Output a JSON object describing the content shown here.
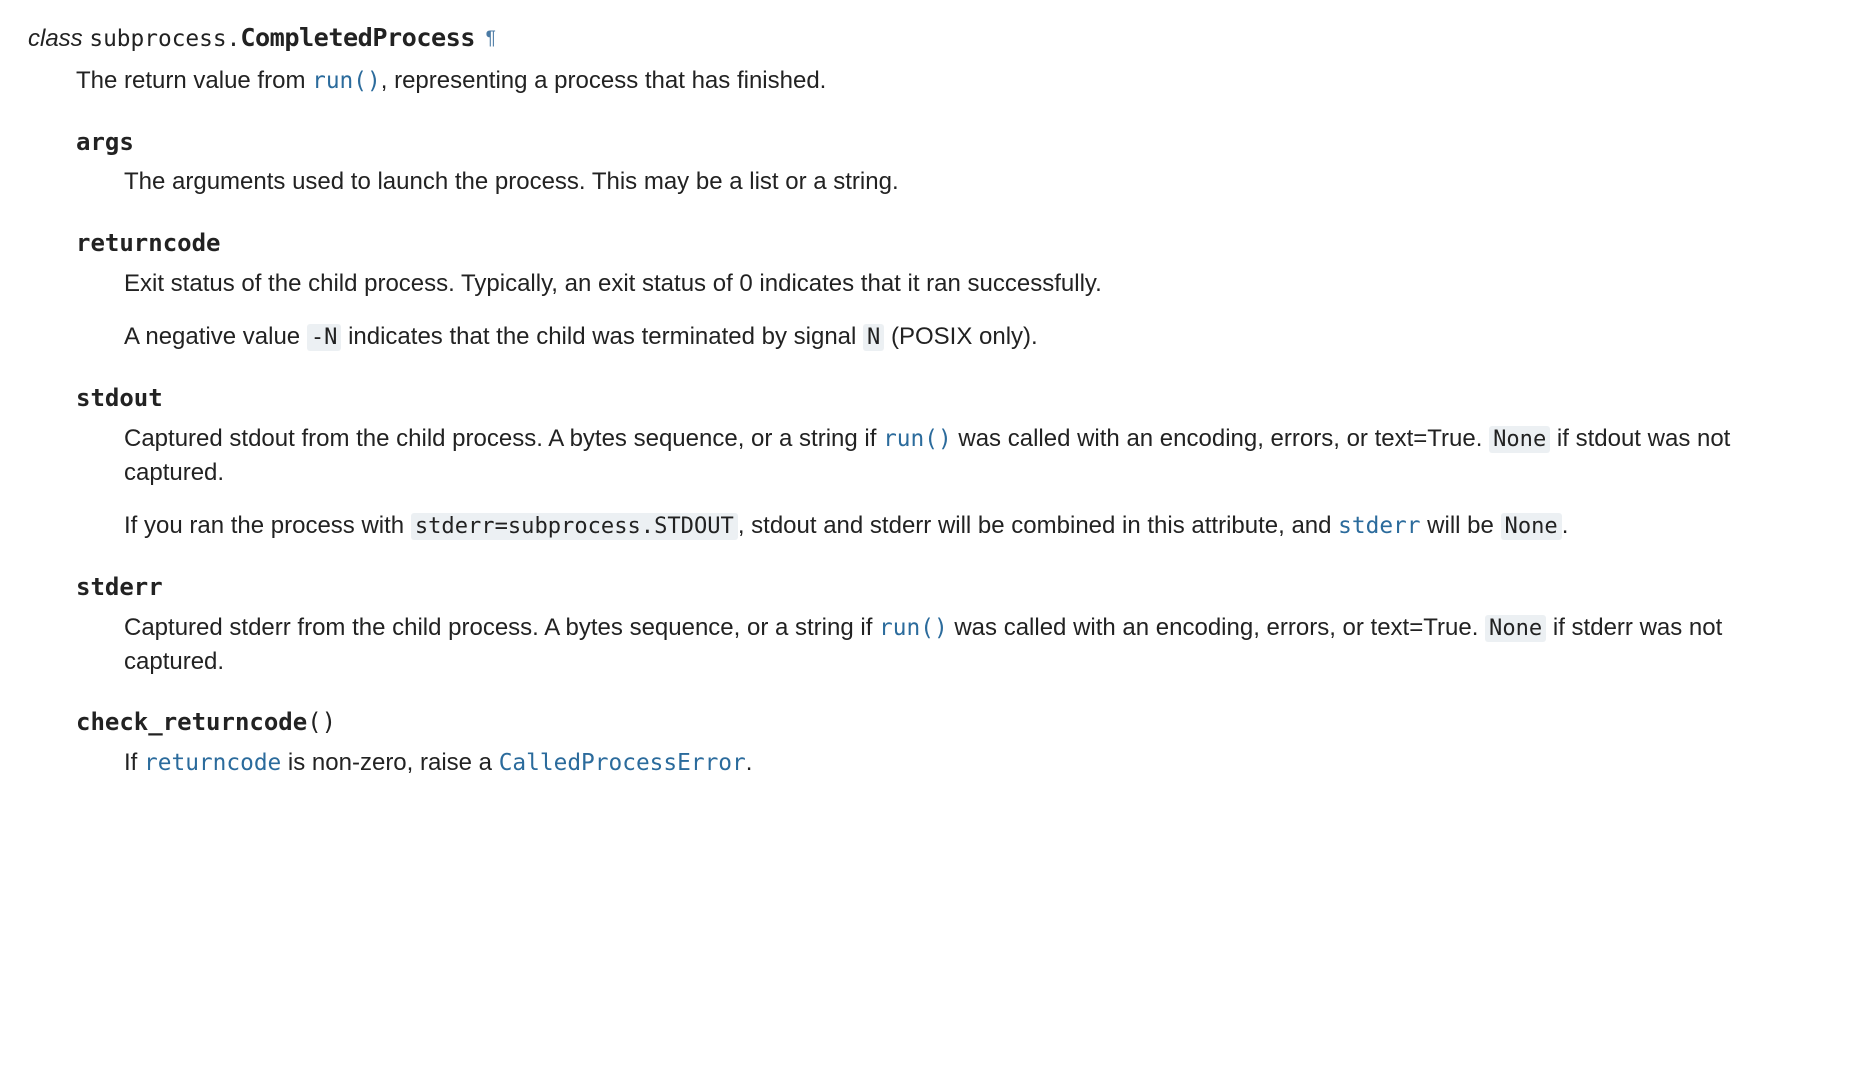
{
  "header": {
    "keyword": "class",
    "module": "subprocess.",
    "name": "CompletedProcess",
    "permalink": "¶"
  },
  "intro": {
    "pre": "The return value from ",
    "run_link": "run()",
    "post": ", representing a process that has finished."
  },
  "attrs": {
    "args": {
      "name": "args",
      "p1": "The arguments used to launch the process. This may be a list or a string."
    },
    "returncode": {
      "name": "returncode",
      "p1": "Exit status of the child process. Typically, an exit status of 0 indicates that it ran successfully.",
      "p2_pre": "A negative value ",
      "p2_code1": "-N",
      "p2_mid": " indicates that the child was terminated by signal ",
      "p2_code2": "N",
      "p2_post": " (POSIX only)."
    },
    "stdout": {
      "name": "stdout",
      "p1_pre": "Captured stdout from the child process. A bytes sequence, or a string if ",
      "p1_run": "run()",
      "p1_mid": " was called with an encoding, errors, or text=True. ",
      "p1_none": "None",
      "p1_post": " if stdout was not captured.",
      "p2_pre": "If you ran the process with ",
      "p2_code": "stderr=subprocess.STDOUT",
      "p2_mid": ", stdout and stderr will be combined in this attribute, and ",
      "p2_stderr": "stderr",
      "p2_mid2": " will be ",
      "p2_none": "None",
      "p2_post": "."
    },
    "stderr": {
      "name": "stderr",
      "p1_pre": "Captured stderr from the child process. A bytes sequence, or a string if ",
      "p1_run": "run()",
      "p1_mid": " was called with an encoding, errors, or text=True. ",
      "p1_none": "None",
      "p1_post": " if stderr was not captured."
    },
    "check_returncode": {
      "name": "check_returncode",
      "parens": "()",
      "p1_pre": "If ",
      "p1_returncode": "returncode",
      "p1_mid": " is non-zero, raise a ",
      "p1_cpe": "CalledProcessError",
      "p1_post": "."
    }
  }
}
